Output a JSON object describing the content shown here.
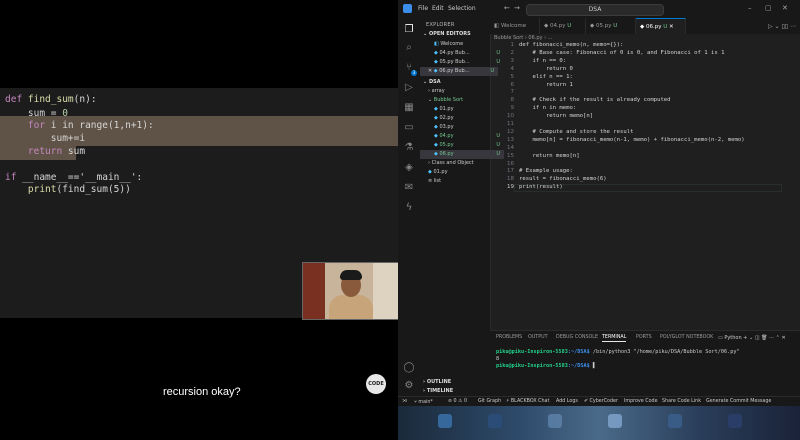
{
  "slide": {
    "lines": [
      {
        "a": "def ",
        "b": "find_sum",
        "c": "(n):"
      },
      {
        "a": "    sum = ",
        "b": "0",
        "c": ""
      },
      {
        "a": "    for ",
        "b": "i in range(1,n+1):",
        "c": ""
      },
      {
        "a": "        sum+=i",
        "b": "",
        "c": ""
      },
      {
        "a": "    return ",
        "b": "sum",
        "c": ""
      },
      {
        "a": "if ",
        "b": "__name__=='__main__':",
        "c": ""
      },
      {
        "a": "    print",
        "b": "(find_sum(5))",
        "c": ""
      }
    ],
    "caption": "recursion okay?",
    "badge": "CODE"
  },
  "titlebar": {
    "menu": [
      "File",
      "Edit",
      "Selection"
    ],
    "search": "DSA",
    "nav_back": "←",
    "nav_forward": "→",
    "minimize": "–",
    "maximize": "▢",
    "close": "✕"
  },
  "explorer": {
    "header": "EXPLORER",
    "open_editors": "OPEN EDITORS",
    "open_files": [
      {
        "name": "Welcome",
        "status": ""
      },
      {
        "name": "04.py  Bub...",
        "status": "U"
      },
      {
        "name": "05.py  Bub...",
        "status": "U"
      },
      {
        "name": "06.py  Bub...",
        "status": "U"
      }
    ],
    "workspace": "DSA",
    "tree": [
      {
        "name": "array",
        "indent": 1,
        "status": "",
        "type": "folder"
      },
      {
        "name": "Bubble Sort",
        "indent": 1,
        "status": "",
        "type": "folder-open"
      },
      {
        "name": "01.py",
        "indent": 2,
        "status": "",
        "type": "py"
      },
      {
        "name": "02.py",
        "indent": 2,
        "status": "",
        "type": "py"
      },
      {
        "name": "03.py",
        "indent": 2,
        "status": "",
        "type": "py"
      },
      {
        "name": "04.py",
        "indent": 2,
        "status": "U",
        "type": "py"
      },
      {
        "name": "05.py",
        "indent": 2,
        "status": "U",
        "type": "py"
      },
      {
        "name": "06.py",
        "indent": 2,
        "status": "U",
        "type": "py"
      },
      {
        "name": "Class and Object",
        "indent": 1,
        "status": "",
        "type": "folder"
      },
      {
        "name": "01.py",
        "indent": 1,
        "status": "",
        "type": "py"
      },
      {
        "name": "list",
        "indent": 1,
        "status": "",
        "type": "file"
      }
    ],
    "outline": "OUTLINE",
    "timeline": "TIMELINE"
  },
  "tabs": [
    {
      "label": "Welcome",
      "status": ""
    },
    {
      "label": "04.py",
      "status": "U"
    },
    {
      "label": "05.py",
      "status": "U"
    },
    {
      "label": "06.py",
      "status": "U"
    }
  ],
  "breadcrumb": "Bubble Sort  ›  06.py  ›  ...",
  "code": [
    "def fibonacci_memo(n, memo={}):",
    "    # Base case: Fibonacci of 0 is 0, and Fibonacci of 1 is 1",
    "    if n == 0:",
    "        return 0",
    "    elif n == 1:",
    "        return 1",
    "",
    "    # Check if the result is already computed",
    "    if n in memo:",
    "        return memo[n]",
    "",
    "    # Compute and store the result",
    "    memo[n] = fibonacci_memo(n-1, memo) + fibonacci_memo(n-2, memo)",
    "",
    "    return memo[n]",
    "",
    "# Example usage:",
    "result = fibonacci_memo(6)",
    "print(result)"
  ],
  "current_line": 19,
  "panel": {
    "tabs": [
      "PROBLEMS",
      "OUTPUT",
      "DEBUG CONSOLE",
      "TERMINAL",
      "PORTS",
      "POLYGLOT NOTEBOOK"
    ],
    "active_tab": "TERMINAL",
    "shell": "Python",
    "terminal": [
      {
        "user": "piku@piku-Inspiron-5583",
        "path": ":~/DSA$",
        "cmd": " /bin/python3 \"/home/piku/DSA/Bubble Sort/06.py\""
      },
      {
        "user": "",
        "path": "",
        "cmd": "8"
      },
      {
        "user": "piku@piku-Inspiron-5583",
        "path": ":~/DSA$",
        "cmd": " "
      }
    ]
  },
  "statusbar": {
    "items": [
      "main*",
      "⊘ 0 ⚠ 0",
      "Git Graph",
      "⚡ BLACKBOX Chat",
      "Add Logs",
      "CyberCoder",
      "Improve Code",
      "Share Code Link",
      "Generate Commit Message"
    ]
  }
}
